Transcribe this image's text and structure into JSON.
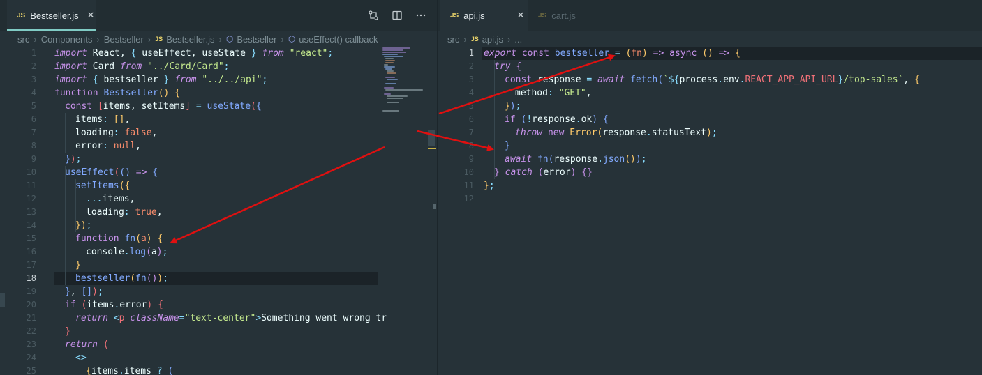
{
  "left": {
    "tab": {
      "icon": "JS",
      "label": "Bestseller.js",
      "close": "✕"
    },
    "actions": [
      "compare-icon",
      "split-editor-icon",
      "more-icon"
    ],
    "breadcrumb": [
      "src",
      "Components",
      "Bestseller",
      "Bestseller.js",
      "Bestseller",
      "useEffect() callback"
    ],
    "line_numbers": [
      "1",
      "2",
      "3",
      "4",
      "5",
      "6",
      "7",
      "8",
      "9",
      "10",
      "11",
      "12",
      "13",
      "14",
      "15",
      "16",
      "17",
      "18",
      "19",
      "20",
      "21",
      "22",
      "23",
      "24",
      "25"
    ],
    "current_line": 18
  },
  "right": {
    "tabs": [
      {
        "icon": "JS",
        "label": "api.js",
        "close": "✕"
      },
      {
        "icon": "JS",
        "label": "cart.js"
      }
    ],
    "breadcrumb": [
      "src",
      "api.js",
      "..."
    ],
    "line_numbers": [
      "1",
      "2",
      "3",
      "4",
      "5",
      "6",
      "7",
      "8",
      "9",
      "10",
      "11",
      "12"
    ],
    "current_line": 1
  },
  "colors": {
    "background": "#263238",
    "arrow": "#e01010",
    "keyword": "#c792ea",
    "function": "#82aaff",
    "string": "#c3e88d"
  }
}
